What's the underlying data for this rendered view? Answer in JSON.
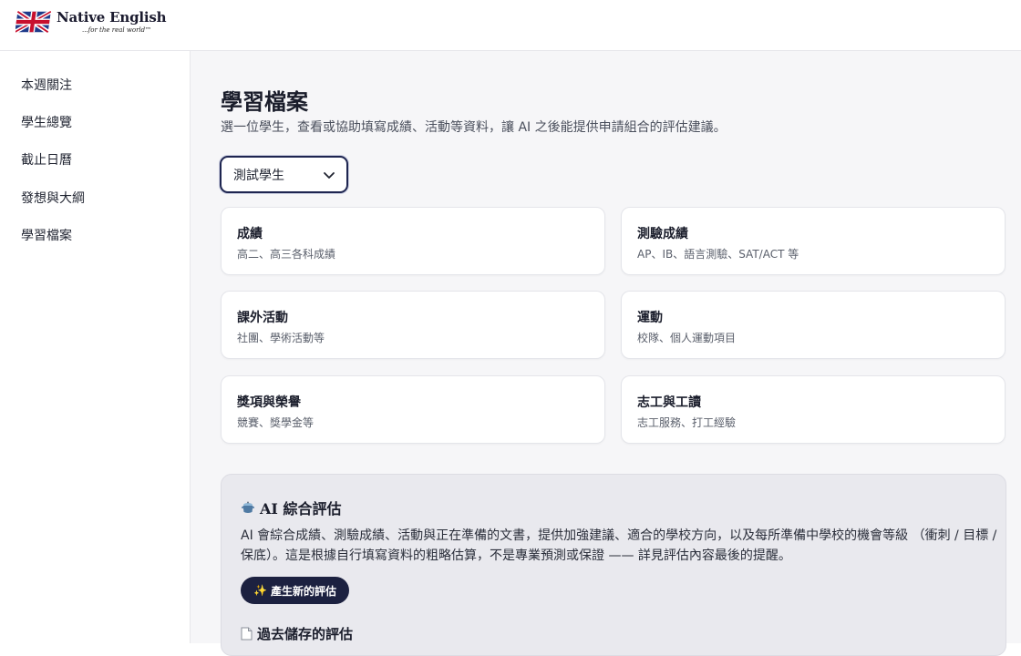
{
  "brand": {
    "name": "Native English",
    "tagline": "...for the real world™"
  },
  "sidebar": {
    "items": [
      {
        "label": "本週關注"
      },
      {
        "label": "學生總覽"
      },
      {
        "label": "截止日曆"
      },
      {
        "label": "發想與大綱"
      },
      {
        "label": "學習檔案"
      }
    ]
  },
  "page": {
    "title": "學習檔案",
    "subtitle": "選一位學生，查看或協助填寫成績、活動等資料，讓 AI 之後能提供申請組合的評估建議。"
  },
  "student_select": {
    "selected": "測試學生"
  },
  "cards": [
    {
      "title": "成績",
      "desc": "高二、高三各科成績"
    },
    {
      "title": "測驗成績",
      "desc": "AP、IB、語言測驗、SAT/ACT 等"
    },
    {
      "title": "課外活動",
      "desc": "社團、學術活動等"
    },
    {
      "title": "運動",
      "desc": "校隊、個人運動項目"
    },
    {
      "title": "獎項與榮譽",
      "desc": "競賽、獎學金等"
    },
    {
      "title": "志工與工讀",
      "desc": "志工服務、打工經驗"
    }
  ],
  "ai_panel": {
    "title": "AI 綜合評估",
    "desc": "AI 會綜合成績、測驗成績、活動與正在準備的文書，提供加強建議、適合的學校方向，以及每所準備中學校的機會等級 （衝刺 / 目標 / 保底）。這是根據自行填寫資料的粗略估算，不是專業預測或保證 —— 詳見評估內容最後的提醒。",
    "generate_label": "產生新的評估",
    "generate_icon": "sparkles-icon",
    "past_title": "過去儲存的評估",
    "title_icon": "pot-icon",
    "past_icon": "document-icon"
  },
  "colors": {
    "accent": "#1c2140",
    "main_bg": "#f6f6f8",
    "panel_bg": "#e9e9ee"
  }
}
